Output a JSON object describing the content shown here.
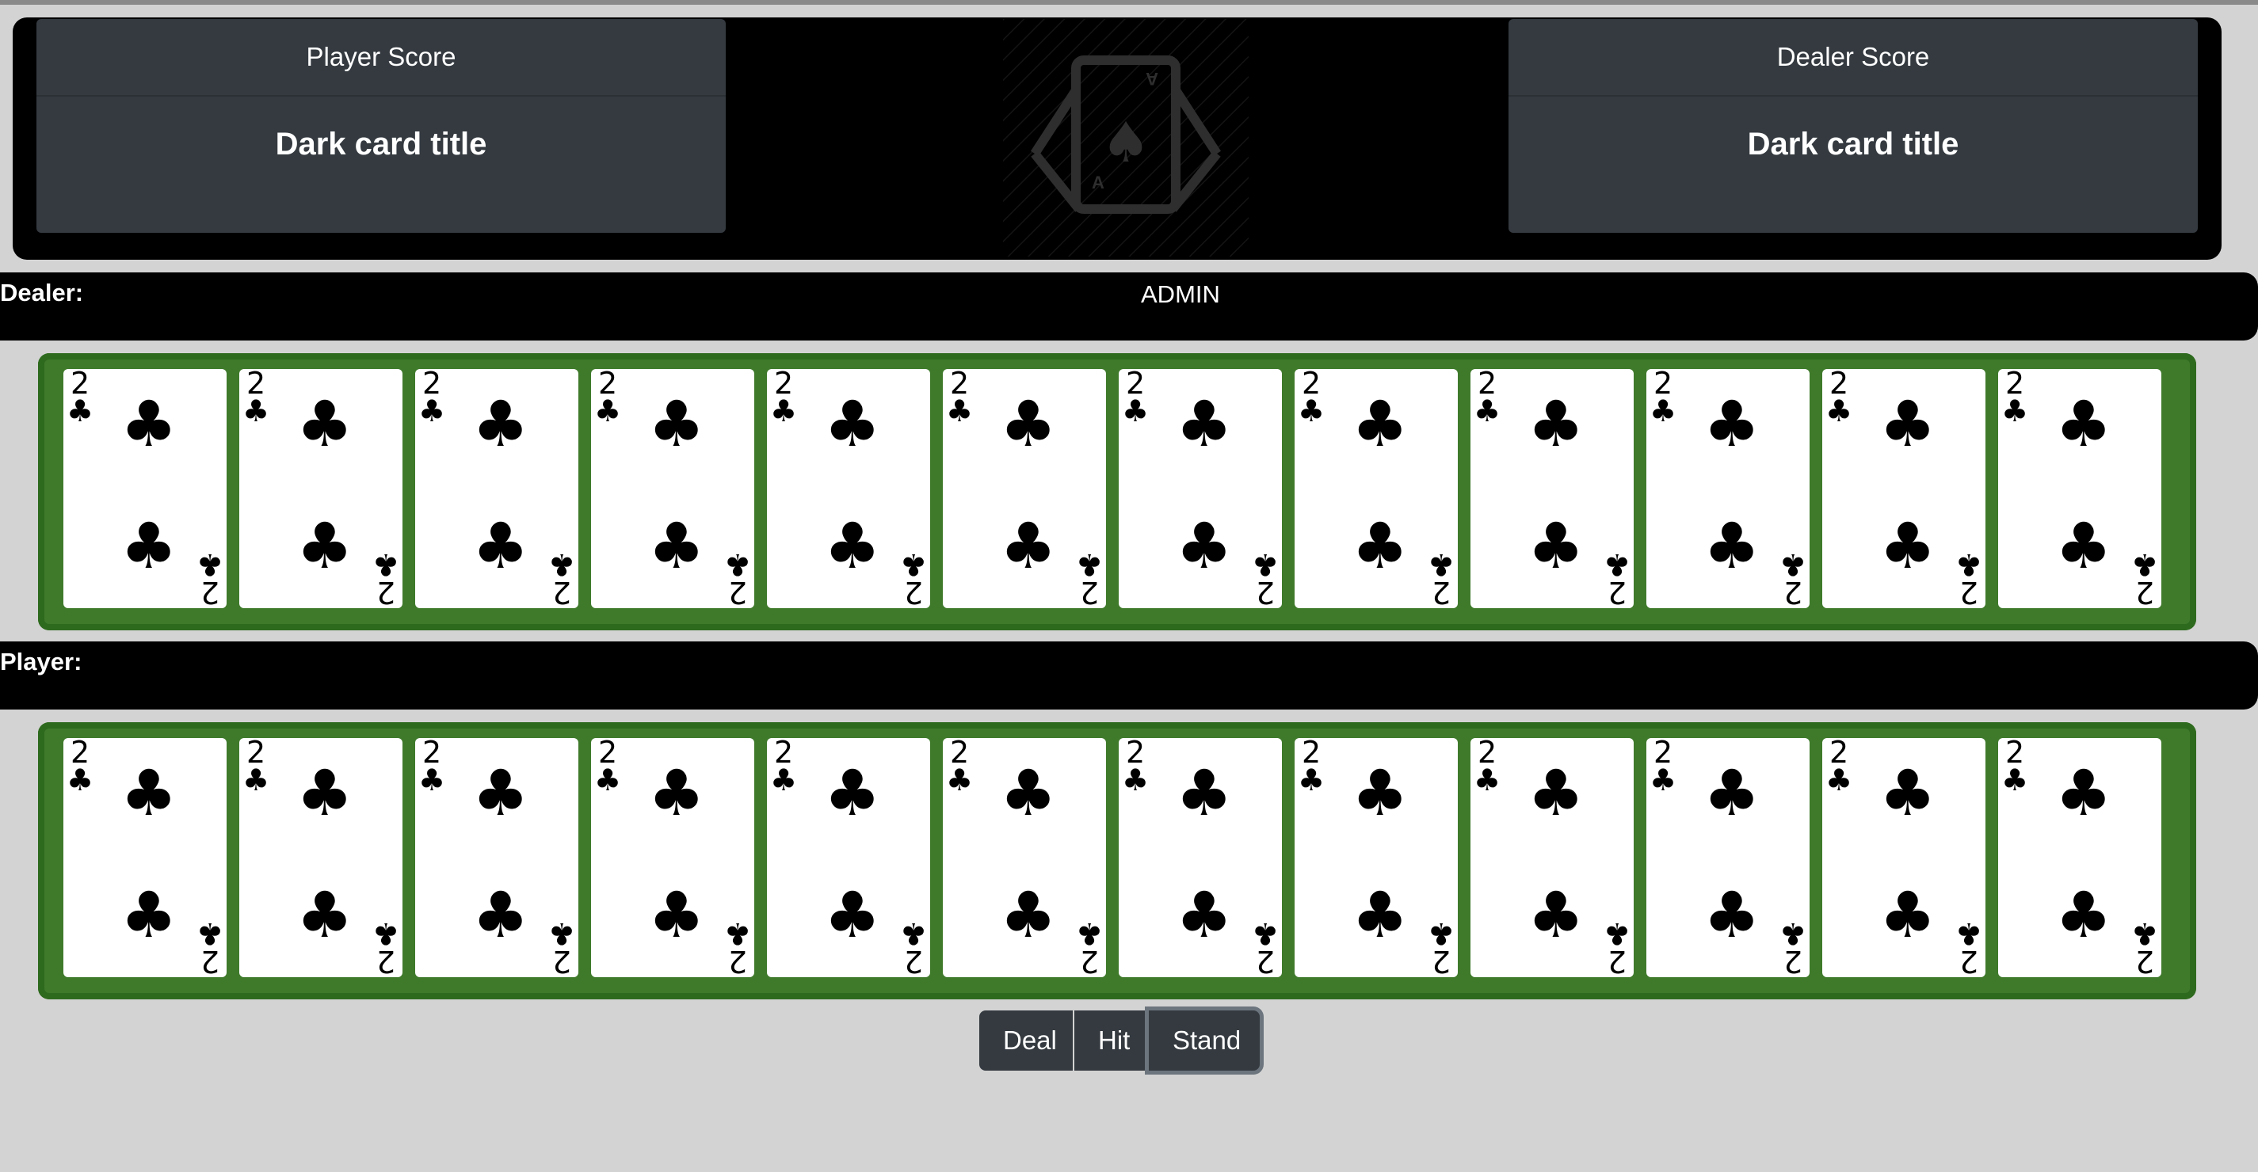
{
  "header": {
    "player_score": {
      "header": "Player Score",
      "title": "Dark card title"
    },
    "dealer_score": {
      "header": "Dealer Score",
      "title": "Dark card title"
    }
  },
  "dealer_bar": {
    "label": "Dealer:",
    "name": "ADMIN"
  },
  "player_bar": {
    "label": "Player:",
    "name": ""
  },
  "dealer_hand": [
    {
      "rank": "2",
      "suit": "♣"
    },
    {
      "rank": "2",
      "suit": "♣"
    },
    {
      "rank": "2",
      "suit": "♣"
    },
    {
      "rank": "2",
      "suit": "♣"
    },
    {
      "rank": "2",
      "suit": "♣"
    },
    {
      "rank": "2",
      "suit": "♣"
    },
    {
      "rank": "2",
      "suit": "♣"
    },
    {
      "rank": "2",
      "suit": "♣"
    },
    {
      "rank": "2",
      "suit": "♣"
    },
    {
      "rank": "2",
      "suit": "♣"
    },
    {
      "rank": "2",
      "suit": "♣"
    },
    {
      "rank": "2",
      "suit": "♣"
    }
  ],
  "player_hand": [
    {
      "rank": "2",
      "suit": "♣"
    },
    {
      "rank": "2",
      "suit": "♣"
    },
    {
      "rank": "2",
      "suit": "♣"
    },
    {
      "rank": "2",
      "suit": "♣"
    },
    {
      "rank": "2",
      "suit": "♣"
    },
    {
      "rank": "2",
      "suit": "♣"
    },
    {
      "rank": "2",
      "suit": "♣"
    },
    {
      "rank": "2",
      "suit": "♣"
    },
    {
      "rank": "2",
      "suit": "♣"
    },
    {
      "rank": "2",
      "suit": "♣"
    },
    {
      "rank": "2",
      "suit": "♣"
    },
    {
      "rank": "2",
      "suit": "♣"
    }
  ],
  "logo": {
    "icon": "playing-cards-icon",
    "rank_top": "A",
    "rank_bottom": "A"
  },
  "controls": {
    "deal_label": "Deal",
    "hit_label": "Hit",
    "stand_label": "Stand"
  },
  "colors": {
    "table_green": "#3f7a2b",
    "button_dark": "#343a40",
    "background": "#d3d3d3"
  }
}
